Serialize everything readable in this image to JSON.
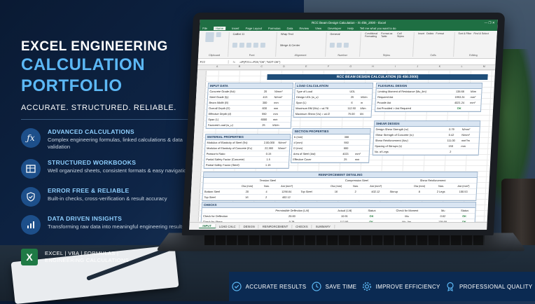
{
  "headline": {
    "line1": "EXCEL ENGINEERING",
    "line2": "CALCULATION",
    "line3": "PORTFOLIO",
    "tagline": "ACCURATE. STRUCTURED. RELIABLE."
  },
  "features": [
    {
      "icon": "function-icon",
      "title": "ADVANCED CALCULATIONS",
      "desc": "Complex engineering formulas, linked calculations & data validation"
    },
    {
      "icon": "workbook-icon",
      "title": "STRUCTURED WORKBOOKS",
      "desc": "Well organized sheets, consistent formats & easy navigation"
    },
    {
      "icon": "shield-check-icon",
      "title": "ERROR FREE & RELIABLE",
      "desc": "Built-in checks, cross-verification & result accuracy"
    },
    {
      "icon": "bar-chart-icon",
      "title": "DATA DRIVEN INSIGHTS",
      "desc": "Transforming raw data into meaningful engineering results"
    }
  ],
  "excel_badge": {
    "letter": "X",
    "line1": "EXCEL | VBA | FORMULAS |",
    "line2": "ENGINEERING CALCULATIONS"
  },
  "bottom_bar": [
    {
      "icon": "target-icon",
      "label": "ACCURATE RESULTS"
    },
    {
      "icon": "clock-icon",
      "label": "SAVE TIME"
    },
    {
      "icon": "gear-icon",
      "label": "IMPROVE EFFICIENCY"
    },
    {
      "icon": "badge-icon",
      "label": "PROFESSIONAL QUALITY"
    }
  ],
  "excel": {
    "window_title": "RCC Beam Design Calculation - IS 456_2000 - Excel",
    "window_controls": "— ❐ ✕",
    "tabs": [
      "File",
      "Home",
      "Insert",
      "Page Layout",
      "Formulas",
      "Data",
      "Review",
      "View",
      "Developer",
      "Help",
      "Tell me what you want to do"
    ],
    "ribbon": {
      "font_name": "Calibri",
      "font_size": "11",
      "wrap_text": "Wrap Text",
      "merge": "Merge & Center",
      "number_format": "General",
      "groups": [
        "Clipboard",
        "Font",
        "Alignment",
        "Number",
        "Styles",
        "Cells",
        "Editing"
      ],
      "cmds": [
        "Conditional Formatting",
        "Format as Table",
        "Cell Styles",
        "Insert",
        "Delete",
        "Format",
        "Sort & Filter",
        "Find & Select"
      ]
    },
    "cell_ref": "F22",
    "formula": "=IF(F21<=F28,\"OK\",\"NOT OK\")",
    "columns": [
      "A",
      "B",
      "C",
      "D",
      "E",
      "F",
      "G",
      "H",
      "I",
      "J",
      "K",
      "L",
      "M"
    ],
    "sheet_title": "RCC BEAM DESIGN CALCULATION (IS 456:2000)",
    "input_data": {
      "header": "INPUT DATA",
      "rows": [
        [
          "Concrete Grade (fck)",
          "20",
          "N/mm²"
        ],
        [
          "Steel Grade (fy)",
          "415",
          "N/mm²"
        ],
        [
          "Beam Width (B)",
          "300",
          "mm"
        ],
        [
          "Overall Depth (D)",
          "600",
          "mm"
        ],
        [
          "Effective Depth (d)",
          "550",
          "mm"
        ],
        [
          "Span (L)",
          "6000",
          "mm"
        ],
        [
          "Factored Load (w_u)",
          "25",
          "kN/m"
        ]
      ]
    },
    "load_calc": {
      "header": "LOAD CALCULATION",
      "rows": [
        [
          "Type of Load",
          "UDL",
          ""
        ],
        [
          "Design UDL (w_u)",
          "25",
          "kN/m"
        ],
        [
          "Span (L)",
          "6",
          "m"
        ],
        [
          "Maximum BM (Mu) = wL²/8",
          "112.50",
          "kNm"
        ],
        [
          "Maximum Shear (Vu) = wL/2",
          "75.00",
          "kN"
        ]
      ]
    },
    "flexural": {
      "header": "FLEXURAL DESIGN",
      "rows": [
        [
          "Limiting Moment of Resistance (Mu_lim)",
          "138.68",
          "kNm"
        ],
        [
          "Required Ast",
          "1953.24",
          "mm²"
        ],
        [
          "Provide Ast",
          "4021.24",
          "mm²"
        ],
        [
          "Ast Provided > Ast Required",
          "OK",
          ""
        ]
      ]
    },
    "material": {
      "header": "MATERIAL PROPERTIES",
      "rows": [
        [
          "Modulus of Elasticity of Steel (Es)",
          "2,00,000",
          "N/mm²"
        ],
        [
          "Modulus of Elasticity of Concrete (Ec)",
          "22,360",
          "N/mm²"
        ],
        [
          "Poisson's Ratio",
          "0.15",
          ""
        ],
        [
          "Partial Safety Factor (Concrete)",
          "1.5",
          ""
        ],
        [
          "Partial Safety Factor (Steel)",
          "1.15",
          ""
        ]
      ]
    },
    "section": {
      "header": "SECTION PROPERTIES",
      "rows": [
        [
          "b (mm)",
          "300",
          ""
        ],
        [
          "d (mm)",
          "550",
          ""
        ],
        [
          "D (mm)",
          "600",
          ""
        ],
        [
          "Area of Steel (Ast)",
          "4021",
          "mm²"
        ],
        [
          "Effective Cover",
          "25",
          "mm"
        ]
      ]
    },
    "shear": {
      "header": "SHEAR DESIGN",
      "rows": [
        [
          "Design Shear Strength (τv)",
          "0.79",
          "N/mm²"
        ],
        [
          "Shear Strength of Concrete (τc)",
          "0.42",
          "N/mm²"
        ],
        [
          "Shear Reinforcement (Asv)",
          "111.00",
          "mm²/m"
        ],
        [
          "Spacing of Stirrups (s)",
          "150",
          "mm"
        ],
        [
          "No. of Legs",
          "2",
          ""
        ]
      ]
    },
    "reinforcement": {
      "header": "REINFORCEMENT DETAILING",
      "tension_title": "Tension Steel",
      "compression_title": "Compression Steel",
      "shear_title": "Shear Reinforcement",
      "cols": [
        "Dia (mm)",
        "Nos.",
        "Ast (mm²)"
      ],
      "tension": [
        [
          "Bottom Steel",
          "20",
          "4",
          "1256.64"
        ],
        [
          "Top Steel",
          "16",
          "2",
          "402.12"
        ]
      ],
      "compression": [
        [
          "Top Steel",
          "16",
          "2",
          "402.12"
        ]
      ],
      "shear": [
        "Stirrup",
        "8",
        "2 Legs",
        "100.53"
      ]
    },
    "checks": {
      "header": "CHECKS",
      "cols": [
        "Permissible Deflection (L/d)",
        "Actual (L/d)",
        "Status",
        "Check for Moment",
        "Mu",
        "Status"
      ],
      "rows": [
        [
          "Check for Deflection",
          "20.00",
          "10.91",
          "OK",
          "Mu",
          "0.62",
          "OK"
        ],
        [
          "Check for Shear",
          "0.79",
          "112.50",
          "OK",
          "Mu_lim",
          "138.68",
          "OK"
        ]
      ]
    },
    "sheet_tabs": [
      "INPUT",
      "LOAD CALC",
      "DESIGN",
      "REINFORCEMENT",
      "CHECKS",
      "SUMMARY"
    ],
    "active_tab": "INPUT",
    "colors": {
      "excel_green": "#1f6f43",
      "header_blue": "#1f4e79",
      "accent": "#5cb8f5"
    }
  }
}
